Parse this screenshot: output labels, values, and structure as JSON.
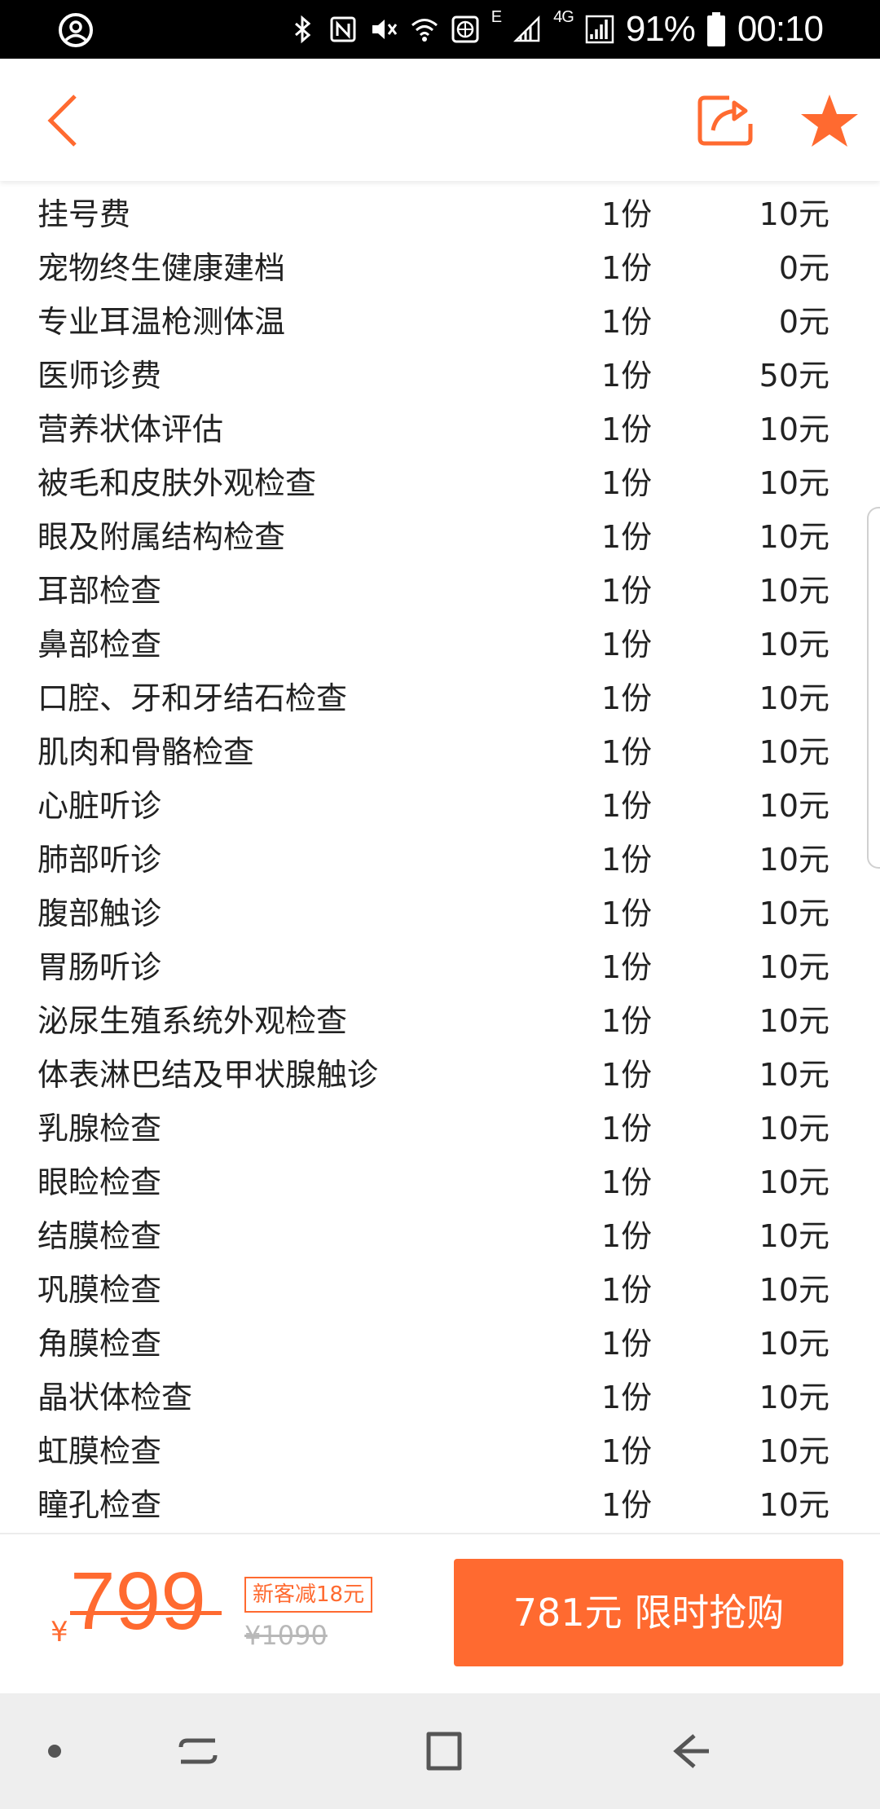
{
  "status_bar": {
    "battery": "91%",
    "time": "00:10",
    "network": "4G",
    "edge": "E"
  },
  "header": {
    "back_icon": "chevron-left-icon",
    "share_icon": "share-icon",
    "favorite_icon": "star-icon",
    "accent_color": "#ff6a30"
  },
  "items": [
    {
      "name": "挂号费",
      "qty": "1份",
      "price": "10元"
    },
    {
      "name": "宠物终生健康建档",
      "qty": "1份",
      "price": "0元"
    },
    {
      "name": "专业耳温枪测体温",
      "qty": "1份",
      "price": "0元"
    },
    {
      "name": "医师诊费",
      "qty": "1份",
      "price": "50元"
    },
    {
      "name": "营养状体评估",
      "qty": "1份",
      "price": "10元"
    },
    {
      "name": "被毛和皮肤外观检查",
      "qty": "1份",
      "price": "10元"
    },
    {
      "name": "眼及附属结构检查",
      "qty": "1份",
      "price": "10元"
    },
    {
      "name": "耳部检查",
      "qty": "1份",
      "price": "10元"
    },
    {
      "name": "鼻部检查",
      "qty": "1份",
      "price": "10元"
    },
    {
      "name": "口腔、牙和牙结石检查",
      "qty": "1份",
      "price": "10元"
    },
    {
      "name": "肌肉和骨骼检查",
      "qty": "1份",
      "price": "10元"
    },
    {
      "name": "心脏听诊",
      "qty": "1份",
      "price": "10元"
    },
    {
      "name": "肺部听诊",
      "qty": "1份",
      "price": "10元"
    },
    {
      "name": "腹部触诊",
      "qty": "1份",
      "price": "10元"
    },
    {
      "name": "胃肠听诊",
      "qty": "1份",
      "price": "10元"
    },
    {
      "name": "泌尿生殖系统外观检查",
      "qty": "1份",
      "price": "10元"
    },
    {
      "name": "体表淋巴结及甲状腺触诊",
      "qty": "1份",
      "price": "10元"
    },
    {
      "name": "乳腺检查",
      "qty": "1份",
      "price": "10元"
    },
    {
      "name": "眼睑检查",
      "qty": "1份",
      "price": "10元"
    },
    {
      "name": "结膜检查",
      "qty": "1份",
      "price": "10元"
    },
    {
      "name": "巩膜检查",
      "qty": "1份",
      "price": "10元"
    },
    {
      "name": "角膜检查",
      "qty": "1份",
      "price": "10元"
    },
    {
      "name": "晶状体检查",
      "qty": "1份",
      "price": "10元"
    },
    {
      "name": "虹膜检查",
      "qty": "1份",
      "price": "10元"
    },
    {
      "name": "瞳孔检查",
      "qty": "1份",
      "price": "10元"
    }
  ],
  "bottom": {
    "currency": "¥",
    "price": "799",
    "badge": "新客减18元",
    "original_price": "¥1090",
    "buy_label": "781元 限时抢购"
  },
  "nav_bar": {
    "icons": [
      "dot-icon",
      "recent-apps-icon",
      "home-icon",
      "back-icon"
    ]
  }
}
